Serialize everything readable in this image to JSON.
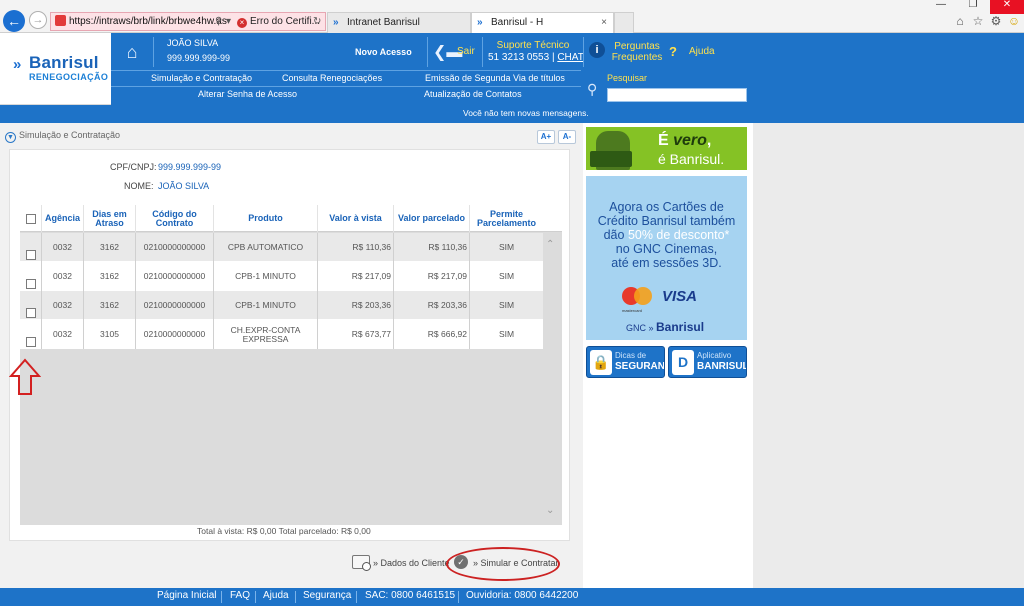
{
  "browser": {
    "url": "https://intraws/brb/link/brbwe4hw.as",
    "cert_error": "Erro do Certifi...",
    "tabs": [
      {
        "title": "Intranet Banrisul"
      },
      {
        "title": "Banrisul - H"
      }
    ]
  },
  "brand": {
    "logo_text": "Banrisul",
    "logo_sub": "RENEGOCIAÇÃO"
  },
  "header": {
    "user_name": "JOÃO SILVA",
    "user_cpf": "999.999.999-99",
    "novo_acesso": "Novo Acesso",
    "sair": "Sair",
    "suporte_title": "Suporte Técnico",
    "suporte_phone": "51 3213 0553",
    "suporte_sep": " | ",
    "chat": "CHAT",
    "perguntas_l1": "Perguntas",
    "perguntas_l2": "Frequentes",
    "ajuda": "Ajuda",
    "pesquisar": "Pesquisar",
    "search_value": ""
  },
  "menu": {
    "row1": [
      "Simulação e Contratação",
      "Consulta Renegociações",
      "Emissão de Segunda Via de títulos"
    ],
    "row2": [
      "Alterar Senha de Acesso",
      "Atualização de Contatos"
    ]
  },
  "message_bar": "Você não tem novas mensagens.",
  "main": {
    "section_title": "Simulação e Contratação",
    "font_increase": "A+",
    "font_decrease": "A-",
    "cpf_label": "CPF/CNPJ:",
    "cpf_value": "999.999.999-99",
    "nome_label": "NOME:",
    "nome_value": "JOÃO SILVA",
    "columns": [
      {
        "l1": "Agência",
        "l2": ""
      },
      {
        "l1": "Dias em",
        "l2": "Atraso"
      },
      {
        "l1": "Código do",
        "l2": "Contrato"
      },
      {
        "l1": "Produto",
        "l2": ""
      },
      {
        "l1": "Valor à vista",
        "l2": ""
      },
      {
        "l1": "Valor parcelado",
        "l2": ""
      },
      {
        "l1": "Permite",
        "l2": "Parcelamento"
      }
    ],
    "rows": [
      {
        "agencia": "0032",
        "dias": "3162",
        "codigo": "0210000000000",
        "produto_l1": "CPB AUTOMATICO",
        "produto_l2": "",
        "vista": "R$ 110,36",
        "parcelado": "R$ 110,36",
        "permite": "SIM"
      },
      {
        "agencia": "0032",
        "dias": "3162",
        "codigo": "0210000000000",
        "produto_l1": "CPB-1 MINUTO",
        "produto_l2": "",
        "vista": "R$ 217,09",
        "parcelado": "R$ 217,09",
        "permite": "SIM"
      },
      {
        "agencia": "0032",
        "dias": "3162",
        "codigo": "0210000000000",
        "produto_l1": "CPB-1 MINUTO",
        "produto_l2": "",
        "vista": "R$ 203,36",
        "parcelado": "R$ 203,36",
        "permite": "SIM"
      },
      {
        "agencia": "0032",
        "dias": "3105",
        "codigo": "0210000000000",
        "produto_l1": "CH.EXPR-CONTA",
        "produto_l2": "EXPRESSA",
        "vista": "R$ 673,77",
        "parcelado": "R$ 666,92",
        "permite": "SIM"
      }
    ],
    "totals": "Total à vista: R$ 0,00   Total parcelado: R$ 0,00",
    "dados_cliente": "» Dados do Cliente",
    "simular_contratar": "» Simular e Contratar"
  },
  "sidebar": {
    "vero_prefix": "É ",
    "vero_word": "vero",
    "vero_suffix": ",",
    "vero_line2": "é Banrisul.",
    "gnc_l1": "Agora os Cartões de",
    "gnc_l2": "Crédito Banrisul também",
    "gnc_l3a": "dão ",
    "gnc_l3b": "50% de desconto*",
    "gnc_l4": "no GNC Cinemas,",
    "gnc_l5": "até em sessões 3D.",
    "mastercard": "mastercard",
    "visa": "VISA",
    "gnc_brand": "GNC",
    "gnc_bank": "Banrisul",
    "dicas_t1": "Dicas de",
    "dicas_t2": "SEGURANÇA",
    "app_t1": "Aplicativo",
    "app_t2": "BANRISUL"
  },
  "footer": [
    "Página Inicial",
    "FAQ",
    "Ajuda",
    "Segurança",
    "SAC: 0800 6461515",
    "Ouvidoria: 0800 6442200"
  ]
}
